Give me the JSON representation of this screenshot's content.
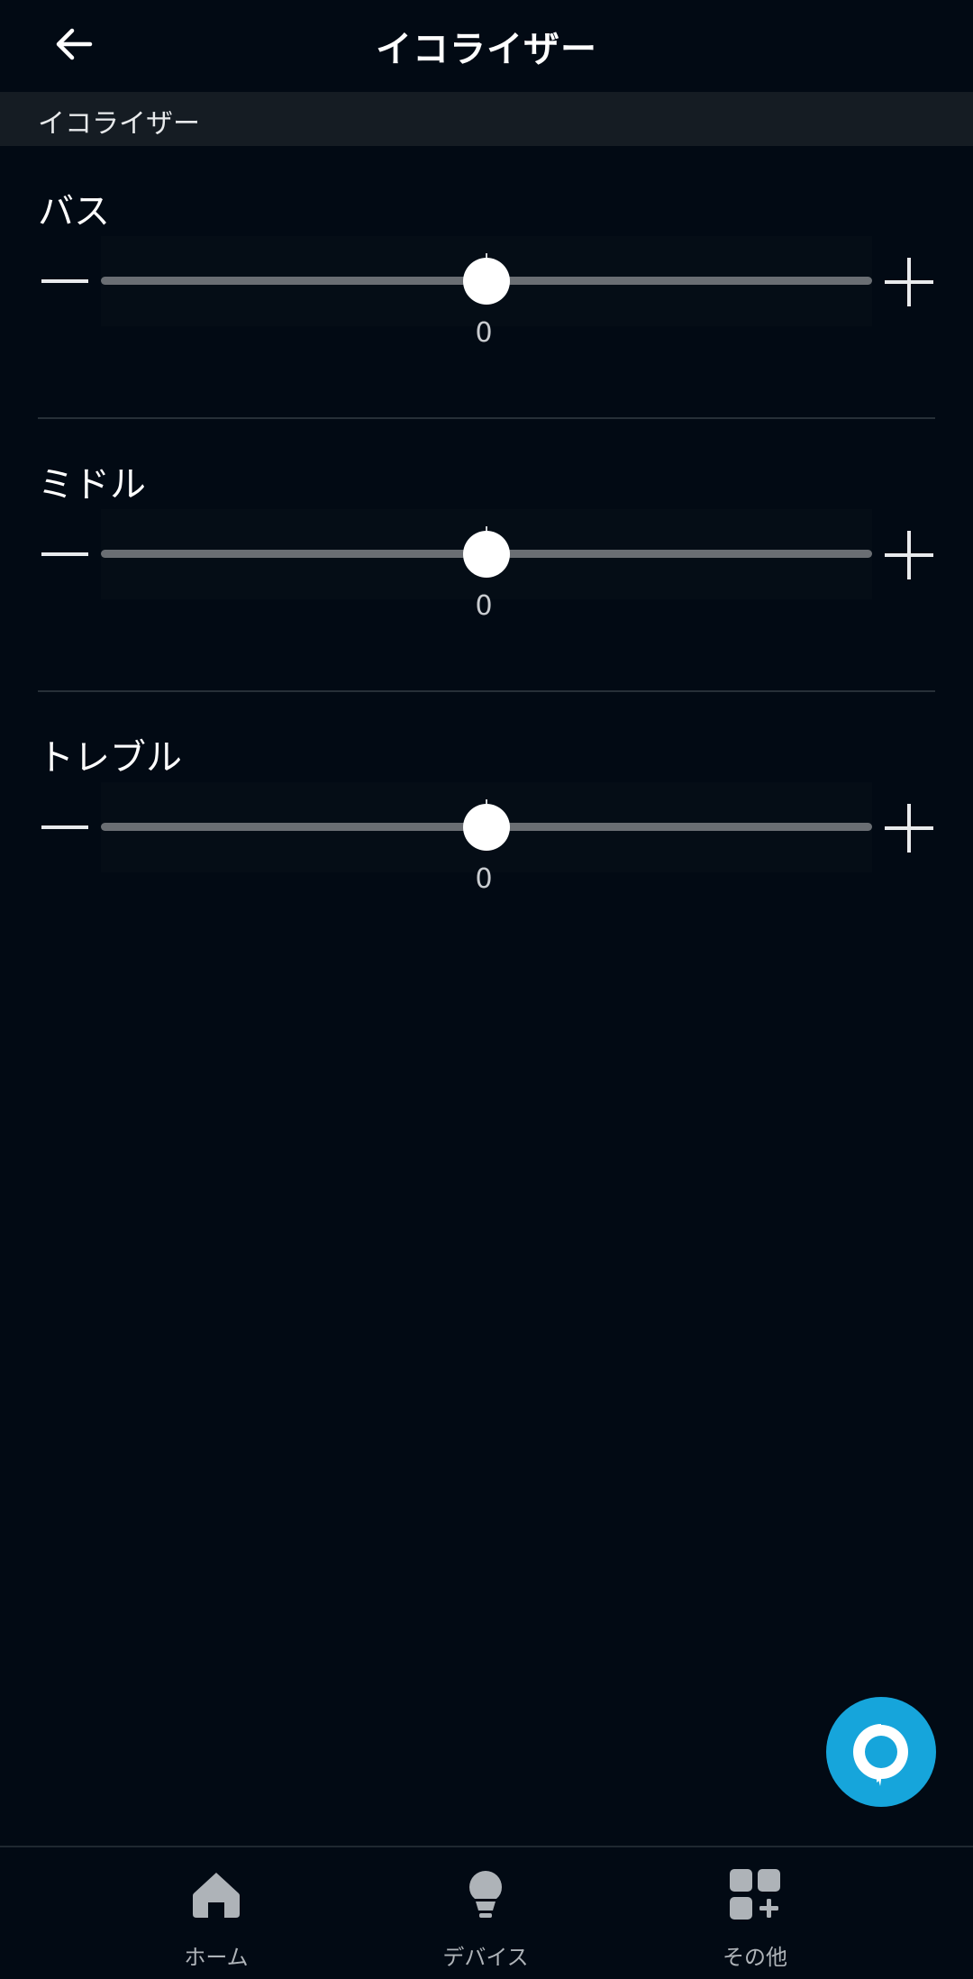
{
  "header": {
    "title": "イコライザー",
    "back_icon": "arrow-left-icon"
  },
  "section": {
    "title": "イコライザー"
  },
  "equalizer": [
    {
      "label": "バス",
      "value": "0",
      "level": 0.5
    },
    {
      "label": "ミドル",
      "value": "0",
      "level": 0.5
    },
    {
      "label": "トレブル",
      "value": "0",
      "level": 0.5
    }
  ],
  "fab": {
    "icon": "alexa-icon"
  },
  "nav": [
    {
      "label": "ホーム",
      "icon": "home-icon"
    },
    {
      "label": "デバイス",
      "icon": "lightbulb-icon"
    },
    {
      "label": "その他",
      "icon": "grid-plus-icon"
    }
  ],
  "colors": {
    "background": "#020a14",
    "accent": "#16a5db",
    "text": "#ffffff"
  }
}
